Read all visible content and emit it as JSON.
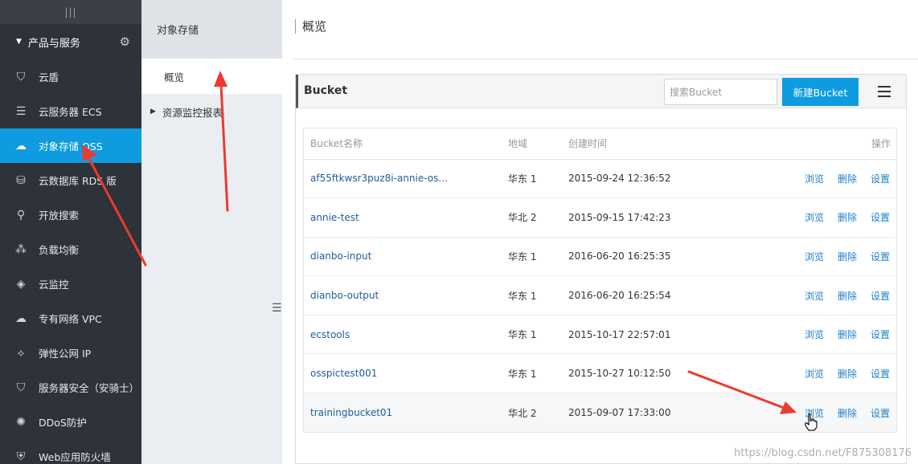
{
  "sidebar": {
    "top_icon": "|||",
    "group_label": "产品与服务",
    "items": [
      {
        "label": "云盾",
        "icon": "shield-icon"
      },
      {
        "label": "云服务器 ECS",
        "icon": "server-icon"
      },
      {
        "label": "对象存储 OSS",
        "icon": "cloud-upload-icon",
        "active": true
      },
      {
        "label": "云数据库 RDS 版",
        "icon": "database-icon"
      },
      {
        "label": "开放搜索",
        "icon": "search-icon"
      },
      {
        "label": "负载均衡",
        "icon": "network-icon"
      },
      {
        "label": "云监控",
        "icon": "monitor-icon"
      },
      {
        "label": "专有网络 VPC",
        "icon": "cloud-icon"
      },
      {
        "label": "弹性公网 IP",
        "icon": "ip-icon"
      },
      {
        "label": "服务器安全（安骑士）",
        "icon": "security-shield-icon"
      },
      {
        "label": "DDoS防护",
        "icon": "ddos-icon"
      },
      {
        "label": "Web应用防火墙",
        "icon": "firewall-icon"
      }
    ]
  },
  "subnav": {
    "title": "对象存储",
    "items": [
      {
        "label": "概览"
      },
      {
        "label": "资源监控报表"
      }
    ]
  },
  "main": {
    "page_title": "概览",
    "panel": {
      "title": "Bucket",
      "search_placeholder": "搜索Bucket",
      "new_button": "新建Bucket"
    },
    "table": {
      "headers": [
        "Bucket名称",
        "地域",
        "创建时间",
        "操作"
      ],
      "rows": [
        {
          "name": "af55ftkwsr3puz8i-annie-os...",
          "region": "华东 1",
          "created": "2015-09-24 12:36:52"
        },
        {
          "name": "annie-test",
          "region": "华北 2",
          "created": "2015-09-15 17:42:23"
        },
        {
          "name": "dianbo-input",
          "region": "华东 1",
          "created": "2016-06-20 16:25:35"
        },
        {
          "name": "dianbo-output",
          "region": "华东 1",
          "created": "2016-06-20 16:25:54"
        },
        {
          "name": "ecstools",
          "region": "华东 1",
          "created": "2015-10-17 22:57:01"
        },
        {
          "name": "osspictest001",
          "region": "华东 1",
          "created": "2015-10-27 10:12:50"
        },
        {
          "name": "trainingbucket01",
          "region": "华北 2",
          "created": "2015-09-07 17:33:00"
        }
      ],
      "actions": {
        "browse": "浏览",
        "delete": "删除",
        "settings": "设置"
      }
    }
  },
  "watermark": "https://blog.csdn.net/F875308176",
  "colors": {
    "accent": "#0e9be0",
    "sidebar_bg": "#2e3239",
    "arrow": "#ea3b2e"
  }
}
